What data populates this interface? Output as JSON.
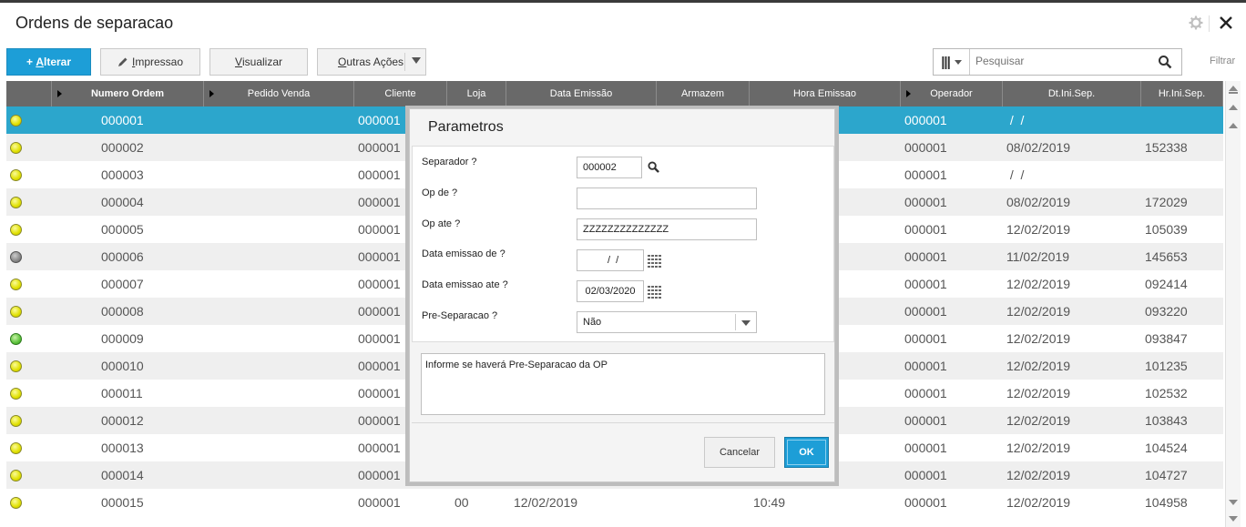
{
  "window": {
    "title": "Ordens de separacao"
  },
  "toolbar": {
    "alterar_prefix": "+ ",
    "alterar_hot": "A",
    "alterar_rest": "lterar",
    "impressao_hot": "I",
    "impressao_rest": "mpressao",
    "visualizar_hot": "V",
    "visualizar_rest": "isualizar",
    "outras_hot": "O",
    "outras_rest": "utras Ações",
    "search_placeholder": "Pesquisar",
    "filtrar_label": "Filtrar"
  },
  "grid": {
    "columns": [
      "",
      "Numero Ordem",
      "Pedido Venda",
      "Cliente",
      "Loja",
      "Data Emissão",
      "Armazem",
      "Hora Emissao",
      "Operador",
      "Dt.Ini.Sep.",
      "Hr.Ini.Sep."
    ],
    "rows": [
      {
        "status": "yellow",
        "ordem": "000001",
        "pedido": "",
        "cliente": "000001",
        "loja": "",
        "data": "",
        "armazem": "",
        "hora": "",
        "operador": "000001",
        "dtini": " /  /",
        "hrini": ""
      },
      {
        "status": "yellow",
        "ordem": "000002",
        "pedido": "",
        "cliente": "000001",
        "loja": "",
        "data": "",
        "armazem": "",
        "hora": "",
        "operador": "000001",
        "dtini": "08/02/2019",
        "hrini": "152338"
      },
      {
        "status": "yellow",
        "ordem": "000003",
        "pedido": "",
        "cliente": "000001",
        "loja": "",
        "data": "",
        "armazem": "",
        "hora": "",
        "operador": "000001",
        "dtini": " /  /",
        "hrini": ""
      },
      {
        "status": "yellow",
        "ordem": "000004",
        "pedido": "",
        "cliente": "000001",
        "loja": "",
        "data": "",
        "armazem": "",
        "hora": "",
        "operador": "000001",
        "dtini": "08/02/2019",
        "hrini": "172029"
      },
      {
        "status": "yellow",
        "ordem": "000005",
        "pedido": "",
        "cliente": "000001",
        "loja": "",
        "data": "",
        "armazem": "",
        "hora": "",
        "operador": "000001",
        "dtini": "12/02/2019",
        "hrini": "105039"
      },
      {
        "status": "gray",
        "ordem": "000006",
        "pedido": "",
        "cliente": "000001",
        "loja": "",
        "data": "",
        "armazem": "",
        "hora": "",
        "operador": "000001",
        "dtini": "11/02/2019",
        "hrini": "145653"
      },
      {
        "status": "yellow",
        "ordem": "000007",
        "pedido": "",
        "cliente": "000001",
        "loja": "",
        "data": "",
        "armazem": "",
        "hora": "",
        "operador": "000001",
        "dtini": "12/02/2019",
        "hrini": "092414"
      },
      {
        "status": "yellow",
        "ordem": "000008",
        "pedido": "",
        "cliente": "000001",
        "loja": "",
        "data": "",
        "armazem": "",
        "hora": "",
        "operador": "000001",
        "dtini": "12/02/2019",
        "hrini": "093220"
      },
      {
        "status": "green",
        "ordem": "000009",
        "pedido": "",
        "cliente": "000001",
        "loja": "",
        "data": "",
        "armazem": "",
        "hora": "",
        "operador": "000001",
        "dtini": "12/02/2019",
        "hrini": "093847"
      },
      {
        "status": "yellow",
        "ordem": "000010",
        "pedido": "",
        "cliente": "000001",
        "loja": "",
        "data": "",
        "armazem": "",
        "hora": "",
        "operador": "000001",
        "dtini": "12/02/2019",
        "hrini": "101235"
      },
      {
        "status": "yellow",
        "ordem": "000011",
        "pedido": "",
        "cliente": "000001",
        "loja": "",
        "data": "",
        "armazem": "",
        "hora": "",
        "operador": "000001",
        "dtini": "12/02/2019",
        "hrini": "102532"
      },
      {
        "status": "yellow",
        "ordem": "000012",
        "pedido": "",
        "cliente": "000001",
        "loja": "",
        "data": "",
        "armazem": "",
        "hora": "",
        "operador": "000001",
        "dtini": "12/02/2019",
        "hrini": "103843"
      },
      {
        "status": "yellow",
        "ordem": "000013",
        "pedido": "",
        "cliente": "000001",
        "loja": "",
        "data": "",
        "armazem": "",
        "hora": "",
        "operador": "000001",
        "dtini": "12/02/2019",
        "hrini": "104524"
      },
      {
        "status": "yellow",
        "ordem": "000014",
        "pedido": "",
        "cliente": "000001",
        "loja": "",
        "data": "",
        "armazem": "",
        "hora": "",
        "operador": "000001",
        "dtini": "12/02/2019",
        "hrini": "104727"
      },
      {
        "status": "yellow",
        "ordem": "000015",
        "pedido": "",
        "cliente": "000001",
        "loja": "00",
        "data": "12/02/2019",
        "armazem": "",
        "hora": "10:49",
        "operador": "000001",
        "dtini": "12/02/2019",
        "hrini": "104958"
      }
    ]
  },
  "dialog": {
    "title": "Parametros",
    "separador_label": "Separador ?",
    "separador_value": "000002",
    "opde_label": "Op de ?",
    "opde_value": "",
    "opate_label": "Op ate ?",
    "opate_value": "ZZZZZZZZZZZZZZ",
    "dtde_label": "Data emissao de ?",
    "dtde_value": "  /  /",
    "dtate_label": "Data emissao ate ?",
    "dtate_value": "02/03/2020",
    "presep_label": "Pre-Separacao ?",
    "presep_value": "Não",
    "help_text": "Informe se haverá Pre-Separacao da OP",
    "cancel_label": "Cancelar",
    "ok_label": "OK"
  },
  "colors": {
    "accent": "#1d9ed7",
    "header_bg": "#696969",
    "selected_row": "#2ca6cc"
  }
}
